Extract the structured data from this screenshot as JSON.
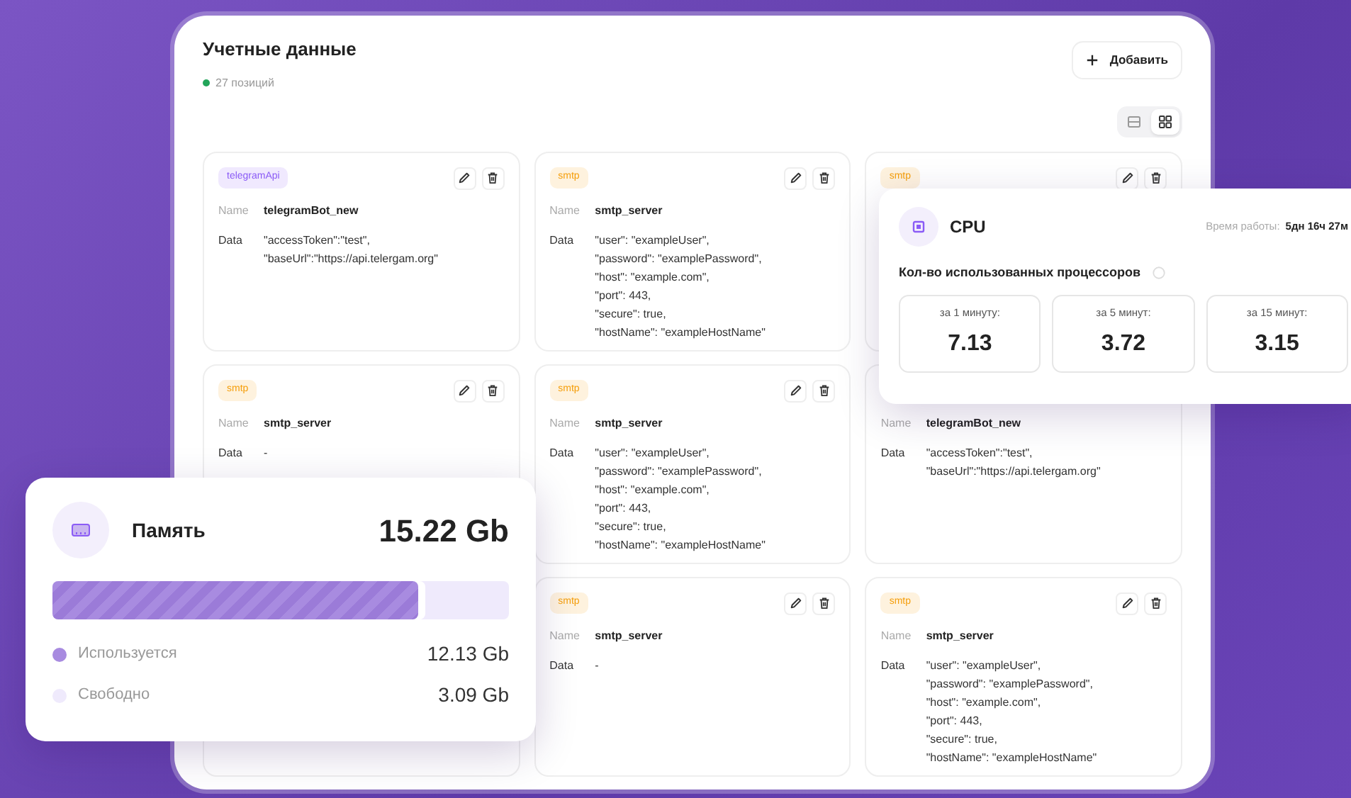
{
  "header": {
    "title": "Учетные данные",
    "count": "27 позиций",
    "add_button": "Добавить"
  },
  "views": [
    {
      "kind": "list",
      "selected": false
    },
    {
      "kind": "grid",
      "selected": true
    }
  ],
  "cards": [
    {
      "tag": "telegramApi",
      "color": "#8b5cf6",
      "actions": true,
      "name_label": "Name",
      "name": "telegramBot_new",
      "data_label": "Data",
      "data": [
        "\"accessToken\":\"test\",",
        "\"baseUrl\":\"https://api.telergam.org\""
      ]
    },
    {
      "tag": "smtp",
      "color": "#f59e0b",
      "actions": true,
      "name_label": "Name",
      "name": "smtp_server",
      "data_label": "Data",
      "data": [
        "\"user\": \"exampleUser\",",
        "\"password\": \"examplePassword\",",
        "\"host\": \"example.com\",",
        "\"port\": 443,",
        "\"secure\": true,",
        "\"hostName\": \"exampleHostName\""
      ]
    },
    {
      "tag": "smtp",
      "color": "#f59e0b",
      "actions": true
    },
    {
      "tag": "smtp",
      "color": "#f59e0b",
      "actions": true,
      "name_label": "Name",
      "name": "smtp_server",
      "data_label": "Data",
      "data": [
        "-"
      ]
    },
    {
      "tag": "smtp",
      "color": "#f59e0b",
      "actions": true,
      "name_label": "Name",
      "name": "smtp_server",
      "data_label": "Data",
      "data": [
        "\"user\": \"exampleUser\",",
        "\"password\": \"examplePassword\",",
        "\"host\": \"example.com\",",
        "\"port\": 443,",
        "\"secure\": true,",
        "\"hostName\": \"exampleHostName\""
      ]
    },
    {
      "actions": false,
      "name_label": "Name",
      "name": "telegramBot_new",
      "data_label": "Data",
      "data": [
        "\"accessToken\":\"test\",",
        "\"baseUrl\":\"https://api.telergam.org\""
      ]
    },
    {
      "actions": false
    },
    {
      "tag": "smtp",
      "color": "#f59e0b",
      "actions": true,
      "name_label": "Name",
      "name": "smtp_server",
      "data_label": "Data",
      "data": [
        "-"
      ]
    },
    {
      "tag": "smtp",
      "color": "#f59e0b",
      "actions": true,
      "name_label": "Name",
      "name": "smtp_server",
      "data_label": "Data",
      "data": [
        "\"user\": \"exampleUser\",",
        "\"password\": \"examplePassword\",",
        "\"host\": \"example.com\",",
        "\"port\": 443,",
        "\"secure\": true,",
        "\"hostName\": \"exampleHostName\""
      ]
    }
  ],
  "cpu": {
    "title": "CPU",
    "uptime_label": "Время работы:",
    "uptime": "5дн 16ч 27м",
    "subtitle": "Кол-во использованных процессоров",
    "stats": [
      {
        "label": "за 1 минуту:",
        "value": "7.13"
      },
      {
        "label": "за 5 минут:",
        "value": "3.72"
      },
      {
        "label": "за 15 минут:",
        "value": "3.15"
      }
    ]
  },
  "memory": {
    "title": "Память",
    "total": "15.22 Gb",
    "level": 0.8,
    "legend": [
      {
        "label": "Используется",
        "value": "12.13 Gb",
        "color": "#a88be0"
      },
      {
        "label": "Свободно",
        "value": "3.09 Gb",
        "color": "#efeafc"
      }
    ]
  }
}
